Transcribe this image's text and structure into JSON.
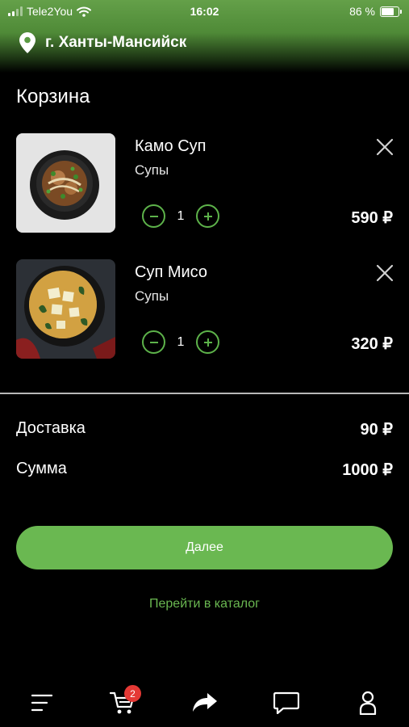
{
  "status_bar": {
    "carrier": "Tele2You",
    "time": "16:02",
    "battery_text": "86 %",
    "battery_level": 0.86
  },
  "header": {
    "location": "г. Ханты-Мансийск",
    "icon": "location-pin-icon"
  },
  "page": {
    "title": "Корзина"
  },
  "cart_items": [
    {
      "name": "Камо Суп",
      "category": "Супы",
      "quantity": "1",
      "price": "590 ₽",
      "image": "kamo-soup-photo"
    },
    {
      "name": "Суп Мисо",
      "category": "Супы",
      "quantity": "1",
      "price": "320 ₽",
      "image": "miso-soup-photo"
    }
  ],
  "summary": {
    "delivery_label": "Доставка",
    "delivery_value": "90 ₽",
    "total_label": "Сумма",
    "total_value": "1000 ₽"
  },
  "actions": {
    "next_label": "Далее",
    "catalog_link": "Перейти в каталог"
  },
  "tab_bar": {
    "items": [
      "menu-icon",
      "cart-icon",
      "share-icon",
      "chat-icon",
      "profile-icon"
    ],
    "cart_badge": "2"
  },
  "colors": {
    "accent": "#6ab851",
    "badge": "#e53935",
    "background": "#000000"
  }
}
